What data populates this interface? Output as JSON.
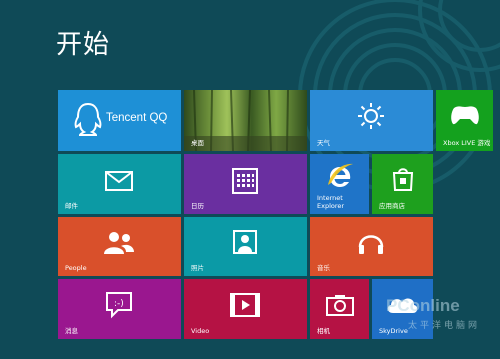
{
  "header": {
    "title": "开始"
  },
  "tiles": {
    "tencent": {
      "label": "Tencent QQ",
      "color": "#1e90d6"
    },
    "desktop": {
      "label": "桌面"
    },
    "weather": {
      "label": "天气",
      "color": "#2b8bd6"
    },
    "xbox": {
      "label": "Xbox LIVE 游戏",
      "color": "#14a11e"
    },
    "mail": {
      "label": "邮件",
      "color": "#0c9aa4"
    },
    "calendar": {
      "label": "日历",
      "color": "#6a2fa0"
    },
    "ie": {
      "label": "Internet Explorer",
      "color": "#1f74c8"
    },
    "store": {
      "label": "应用商店",
      "color": "#1ea01e"
    },
    "people": {
      "label": "People",
      "color": "#d9502b"
    },
    "photos": {
      "label": "照片",
      "color": "#0b9aa6"
    },
    "music": {
      "label": "音乐",
      "color": "#d9502b"
    },
    "messaging": {
      "label": "消息",
      "color": "#9a178f"
    },
    "video": {
      "label": "Video",
      "color": "#b51244"
    },
    "camera": {
      "label": "相机",
      "color": "#b51244"
    },
    "skydrive": {
      "label": "SkyDrive",
      "color": "#1f6fc6"
    }
  },
  "watermark": {
    "text": "PConline",
    "sub": "太平洋电脑网"
  }
}
